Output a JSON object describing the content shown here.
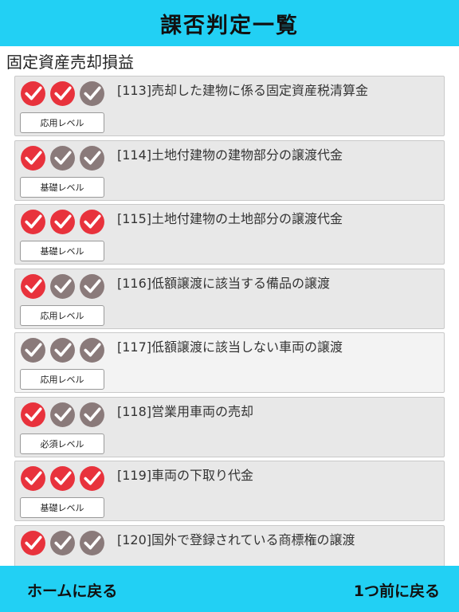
{
  "header": {
    "title": "課否判定一覧"
  },
  "section": {
    "title": "固定資産売却損益"
  },
  "colors": {
    "accent": "#22d0f4",
    "check_on": "#e8323c",
    "check_off": "#8a7a7a"
  },
  "items": [
    {
      "title": "[113]売却した建物に係る固定資産税清算金",
      "level": "応用レベル",
      "checks": [
        true,
        true,
        false
      ]
    },
    {
      "title": "[114]土地付建物の建物部分の譲渡代金",
      "level": "基礎レベル",
      "checks": [
        true,
        false,
        false
      ]
    },
    {
      "title": "[115]土地付建物の土地部分の譲渡代金",
      "level": "基礎レベル",
      "checks": [
        true,
        true,
        true
      ]
    },
    {
      "title": "[116]低額譲渡に該当する備品の譲渡",
      "level": "応用レベル",
      "checks": [
        true,
        false,
        false
      ]
    },
    {
      "title": "[117]低額譲渡に該当しない車両の譲渡",
      "level": "応用レベル",
      "checks": [
        false,
        false,
        false
      ]
    },
    {
      "title": "[118]営業用車両の売却",
      "level": "必須レベル",
      "checks": [
        true,
        false,
        false
      ]
    },
    {
      "title": "[119]車両の下取り代金",
      "level": "基礎レベル",
      "checks": [
        true,
        true,
        true
      ]
    },
    {
      "title": "[120]国外で登録されている商標権の譲渡",
      "level": "",
      "checks": [
        true,
        false,
        false
      ]
    }
  ],
  "footer": {
    "home_label": "ホームに戻る",
    "back_label": "1つ前に戻る"
  }
}
